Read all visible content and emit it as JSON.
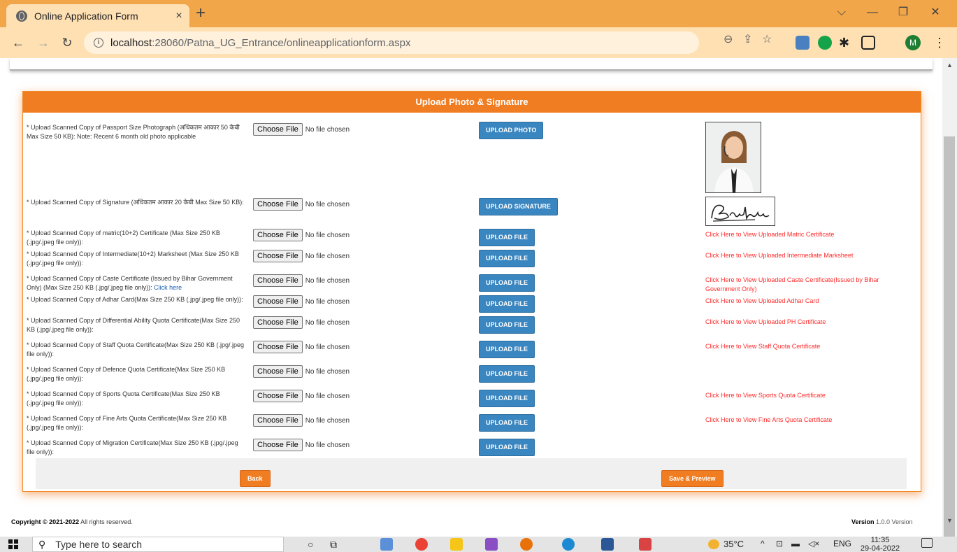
{
  "browser": {
    "tab_title": "Online Application Form",
    "tab_close": "×",
    "new_tab": "+",
    "url_host": "localhost",
    "url_rest": ":28060/Patna_UG_Entrance/onlineapplicationform.aspx",
    "profile_initial": "M"
  },
  "panel": {
    "title": "Upload Photo & Signature"
  },
  "file_control": {
    "choose_label": "Choose File",
    "no_file_label": "No file chosen"
  },
  "rows": [
    {
      "label": "* Upload Scanned Copy of Passport Size Photograph (अधिकतम आकार 50 केबी Max Size 50 KB): Note: Recent 6 month old photo applicable",
      "button": "UPLOAD PHOTO",
      "link": ""
    },
    {
      "label": "* Upload Scanned Copy of Signature (अधिकतम आकार 20 केबी Max Size 50 KB):",
      "button": "UPLOAD SIGNATURE",
      "link": ""
    },
    {
      "label": "* Upload Scanned Copy of matric(10+2) Certificate (Max Size 250 KB (.jpg/.jpeg file only)):",
      "button": "UPLOAD FILE",
      "link": "Click Here to View Uploaded Matric Certificate"
    },
    {
      "label": "* Upload Scanned Copy of Intermediate(10+2) Marksheet (Max Size 250 KB (.jpg/.jpeg file only)):",
      "button": "UPLOAD FILE",
      "link": "Click Here to View Uploaded Intermediate Marksheet"
    },
    {
      "label": "* Upload Scanned Copy of Caste Certificate (Issued by Bihar Government Only) (Max Size 250 KB (.jpg/.jpeg file only)):",
      "label_link": "Click here",
      "button": "UPLOAD FILE",
      "link": "Click Here to View Uploaded Caste Certificate(Issued by Bihar Government Only)"
    },
    {
      "label": "* Upload Scanned Copy of Adhar Card(Max Size 250 KB (.jpg/.jpeg file only)):",
      "button": "UPLOAD FILE",
      "link": "Click Here to View Uploaded Adhar Card"
    },
    {
      "label": "* Upload Scanned Copy of Differential Ability Quota Certificate(Max Size 250 KB (.jpg/.jpeg file only)):",
      "button": "UPLOAD FILE",
      "link": "Click Here to View Uploaded PH Certificate"
    },
    {
      "label": "* Upload Scanned Copy of Staff Quota Certificate(Max Size 250 KB (.jpg/.jpeg file only)):",
      "button": "UPLOAD FILE",
      "link": "Click Here to View Staff Quota Certificate"
    },
    {
      "label": "* Upload Scanned Copy of Defence Quota Certificate(Max Size 250 KB (.jpg/.jpeg file only)):",
      "button": "UPLOAD FILE",
      "link": ""
    },
    {
      "label": "* Upload Scanned Copy of Sports Quota Certificate(Max Size 250 KB (.jpg/.jpeg file only)):",
      "button": "UPLOAD FILE",
      "link": "Click Here to View Sports Quota Certificate"
    },
    {
      "label": "* Upload Scanned Copy of Fine Arts Quota Certificate(Max Size 250 KB (.jpg/.jpeg file only)):",
      "button": "UPLOAD FILE",
      "link": "Click Here to View Fine Arts Quota Certificate"
    },
    {
      "label": "* Upload Scanned Copy of Migration Certificate(Max Size 250 KB (.jpg/.jpeg file only)):",
      "button": "UPLOAD FILE",
      "link": ""
    }
  ],
  "actions": {
    "back": "Back",
    "save_preview": "Save & Preview"
  },
  "footer": {
    "copyright_bold": "Copyright © 2021-2022",
    "copyright_rest": " All rights reserved.",
    "version_bold": "Version",
    "version_rest": " 1.0.0 Version"
  },
  "taskbar": {
    "search_placeholder": "Type here to search",
    "weather": "35°C",
    "lang": "ENG",
    "time": "11:35",
    "date": "29-04-2022"
  },
  "colors": {
    "accent": "#f07d21",
    "upload_button": "#3a86c0",
    "link": "#ff2a2a"
  }
}
